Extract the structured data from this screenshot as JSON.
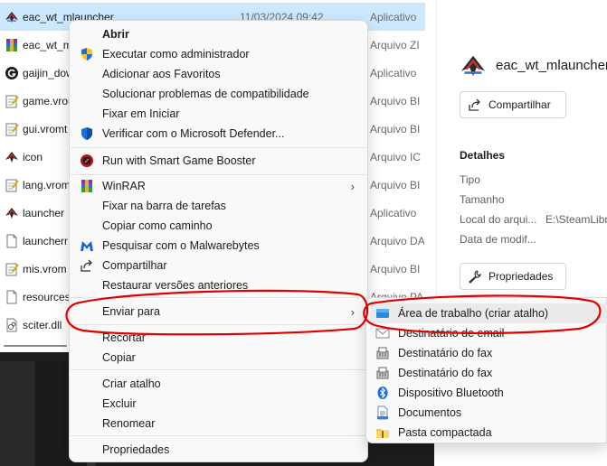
{
  "files": [
    {
      "name": "eac_wt_mlauncher",
      "date": "11/03/2024 09:42",
      "type": "Aplicativo",
      "icon": "eac-app-icon",
      "selected": true
    },
    {
      "name": "eac_wt_m",
      "date": "",
      "type": "Arquivo ZI",
      "icon": "winrar-archive-icon"
    },
    {
      "name": "gaijin_dow",
      "date": "",
      "type": "Aplicativo",
      "icon": "gaijin-app-icon"
    },
    {
      "name": "game.vrom",
      "date": "",
      "type": "Arquivo BI",
      "icon": "notepad-file-icon"
    },
    {
      "name": "gui.vromt",
      "date": "",
      "type": "Arquivo BI",
      "icon": "notepad-file-icon"
    },
    {
      "name": "icon",
      "date": "",
      "type": "Arquivo IC",
      "icon": "eac-app-icon"
    },
    {
      "name": "lang.vrom",
      "date": "",
      "type": "Arquivo BI",
      "icon": "notepad-file-icon"
    },
    {
      "name": "launcher",
      "date": "",
      "type": "Aplicativo",
      "icon": "eac-app-icon"
    },
    {
      "name": "launcherr",
      "date": "",
      "type": "Arquivo DA",
      "icon": "blank-file-icon"
    },
    {
      "name": "mis.vrom",
      "date": "",
      "type": "Arquivo BI",
      "icon": "notepad-file-icon"
    },
    {
      "name": "resources",
      "date": "",
      "type": "Arquivo PA",
      "icon": "blank-file-icon"
    },
    {
      "name": "sciter.dll",
      "date": "",
      "type": "",
      "icon": "dll-file-icon"
    }
  ],
  "details": {
    "title": "eac_wt_mlauncher",
    "share_label": "Compartilhar",
    "heading": "Detalhes",
    "rows": [
      {
        "label": "Tipo",
        "value": ""
      },
      {
        "label": "Tamanho",
        "value": ""
      },
      {
        "label": "Local do arqui...",
        "value": "E:\\SteamLibra"
      },
      {
        "label": "Data de modif...",
        "value": ""
      }
    ],
    "properties_label": "Propriedades"
  },
  "context_menu": {
    "items": [
      {
        "label": "Abrir",
        "icon": "",
        "bold": true,
        "submenu": false
      },
      {
        "label": "Executar como administrador",
        "icon": "uac-shield-icon",
        "submenu": false
      },
      {
        "label": "Adicionar aos Favoritos",
        "icon": "",
        "submenu": false
      },
      {
        "label": "Solucionar problemas de compatibilidade",
        "icon": "",
        "submenu": false
      },
      {
        "label": "Fixar em Iniciar",
        "icon": "",
        "submenu": false
      },
      {
        "label": "Verificar com o Microsoft Defender...",
        "icon": "defender-shield-icon",
        "submenu": false
      },
      {
        "label": "Run with Smart Game Booster",
        "icon": "game-booster-icon",
        "submenu": false
      },
      {
        "label": "WinRAR",
        "icon": "winrar-icon",
        "submenu": true
      },
      {
        "label": "Fixar na barra de tarefas",
        "icon": "",
        "submenu": false
      },
      {
        "label": "Copiar como caminho",
        "icon": "",
        "submenu": false
      },
      {
        "label": "Pesquisar com o Malwarebytes",
        "icon": "malwarebytes-icon",
        "submenu": false
      },
      {
        "label": "Compartilhar",
        "icon": "share-icon",
        "submenu": false
      },
      {
        "label": "Restaurar versões anteriores",
        "icon": "",
        "submenu": false
      },
      {
        "label": "Enviar para",
        "icon": "",
        "submenu": true
      },
      {
        "label": "Recortar",
        "icon": "",
        "submenu": false
      },
      {
        "label": "Copiar",
        "icon": "",
        "submenu": false
      },
      {
        "label": "Criar atalho",
        "icon": "",
        "submenu": false
      },
      {
        "label": "Excluir",
        "icon": "",
        "submenu": false
      },
      {
        "label": "Renomear",
        "icon": "",
        "submenu": false
      },
      {
        "label": "Propriedades",
        "icon": "",
        "submenu": false
      }
    ]
  },
  "send_to_menu": {
    "items": [
      {
        "label": "Área de trabalho (criar atalho)",
        "icon": "desktop-icon"
      },
      {
        "label": "Destinatário de email",
        "icon": "mail-icon"
      },
      {
        "label": "Destinatário do fax",
        "icon": "fax-icon"
      },
      {
        "label": "Destinatário do fax",
        "icon": "fax-icon"
      },
      {
        "label": "Dispositivo Bluetooth",
        "icon": "bluetooth-icon"
      },
      {
        "label": "Documentos",
        "icon": "documents-icon"
      },
      {
        "label": "Pasta compactada",
        "icon": "zip-folder-icon"
      }
    ]
  },
  "colors": {
    "selection": "#cce8ff",
    "annotation": "#e00000",
    "menu_bg": "#f9f9f9"
  }
}
